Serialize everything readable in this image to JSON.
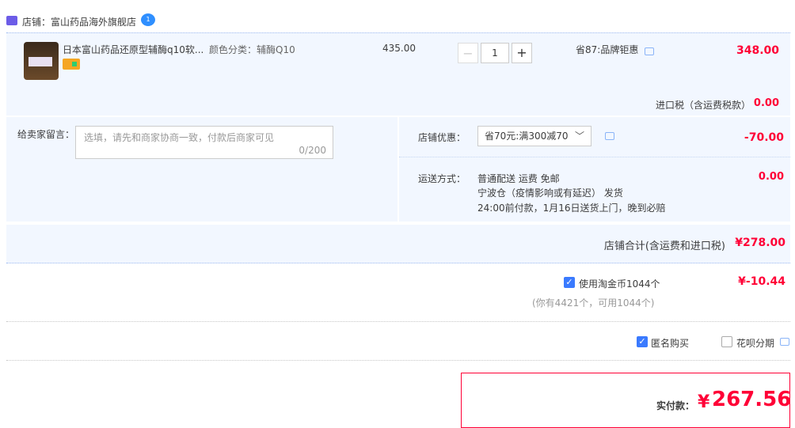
{
  "shop": {
    "label": "店铺：",
    "name": "富山药品海外旗舰店"
  },
  "item": {
    "title": "日本富山药品还原型辅酶q10软...",
    "sku": "颜色分类：辅酶Q10",
    "price": "435.00",
    "quantity": "1",
    "discount_text": "省87:品牌钜惠",
    "subtotal": "348.00",
    "tax_label": "进口税（含运费税款）",
    "tax_value": "0.00"
  },
  "note": {
    "label": "给卖家留言：",
    "placeholder": "选填，请先和商家协商一致，付款后商家可见",
    "count": "0/200"
  },
  "promo": {
    "label": "店铺优惠：",
    "selected": "省70元:满300减70",
    "value": "-70.00"
  },
  "shipping": {
    "label": "运送方式：",
    "line1": "普通配送 运费 免邮",
    "line2": "宁波仓（疫情影响或有延迟） 发货",
    "line3": "24:00前付款，1月16日送货上门，晚到必赔",
    "value": "0.00"
  },
  "shop_total": {
    "label": "店铺合计(含运费和进口税)",
    "value": "¥278.00"
  },
  "coins": {
    "label": "使用淘金币1044个",
    "sub": "(你有4421个，可用1044个)",
    "value": "¥-10.44",
    "checked": true
  },
  "options": {
    "anonymous_label": "匿名购买",
    "anonymous_checked": true,
    "huabei_label": "花呗分期",
    "huabei_checked": false
  },
  "payment": {
    "label": "实付款：",
    "currency": "¥",
    "amount": "267.56"
  },
  "colors": {
    "accent_red": "#ff0036",
    "panel_bg": "#f2f7ff",
    "check_blue": "#3a7afe"
  }
}
